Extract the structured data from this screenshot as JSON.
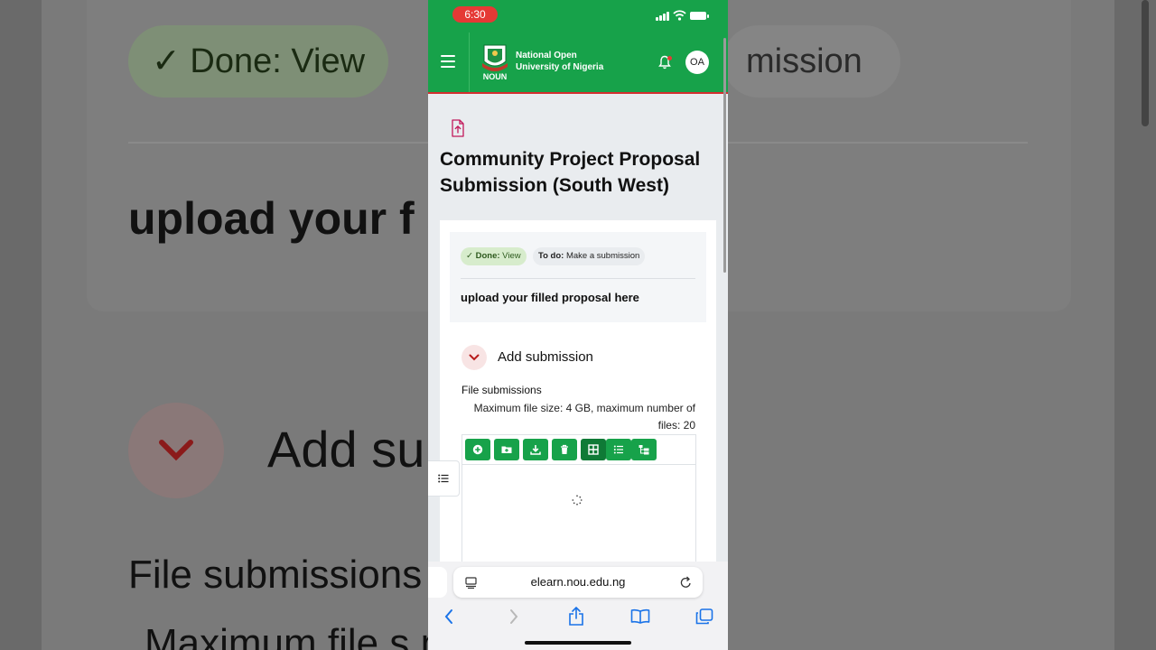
{
  "background": {
    "done_label": "✓ Done: View",
    "todo_label": "mission",
    "heading": "upload your f                    al here",
    "add_label": "Add su",
    "files_label": "File submissions",
    "max_label": "Maximum file s                    mum number of"
  },
  "status_bar": {
    "time": "6:30",
    "time_color": "#e53935"
  },
  "header": {
    "university_line1": "National Open",
    "university_line2": "University of Nigeria",
    "logo_text": "NOUN",
    "avatar_initials": "OA",
    "brand_color": "#17a24a",
    "accent_color": "#d32f2f"
  },
  "page": {
    "title": "Community Project Proposal Submission (South West)",
    "icon": "file-upload-icon"
  },
  "activity": {
    "done_label": "Done:",
    "done_value": "View",
    "todo_label": "To do:",
    "todo_value": "Make a submission",
    "instructions": "upload your filled proposal here"
  },
  "submission": {
    "section_title": "Add submission",
    "files_label": "File submissions",
    "max_info": "Maximum file size: 4 GB, maximum number of files: 20",
    "toolbar": [
      "add-file-icon",
      "create-folder-icon",
      "download-icon",
      "delete-icon",
      "grid-view-icon",
      "list-view-icon",
      "tree-view-icon"
    ]
  },
  "browser": {
    "url": "elearn.nou.edu.ng"
  }
}
